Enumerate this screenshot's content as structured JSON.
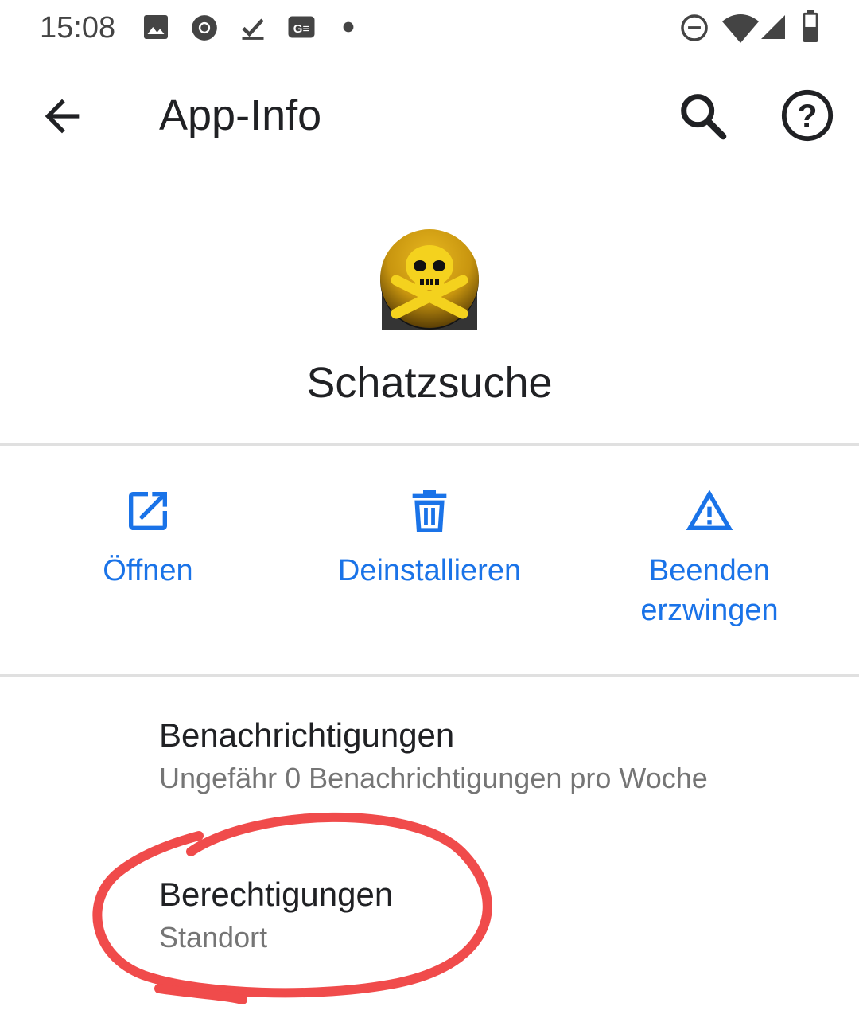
{
  "status_bar": {
    "time": "15:08",
    "icons_left": [
      "image-icon",
      "chrome-icon",
      "download-done-icon",
      "translate-icon",
      "dot-icon"
    ],
    "icons_right": [
      "do-not-disturb-icon",
      "wifi-icon",
      "signal-icon",
      "battery-icon"
    ]
  },
  "appbar": {
    "title": "App-Info",
    "back_icon": "arrow-back-icon",
    "search_icon": "search-icon",
    "help_icon": "help-icon"
  },
  "app": {
    "name": "Schatzsuche",
    "icon": "skull-crossbones-icon"
  },
  "actions": [
    {
      "label": "Öffnen",
      "icon": "open-in-new-icon"
    },
    {
      "label": "Deinstallieren",
      "icon": "trash-icon"
    },
    {
      "label_line1": "Beenden",
      "label_line2": "erzwingen",
      "icon": "warning-icon"
    }
  ],
  "list": [
    {
      "title": "Benachrichtigungen",
      "subtitle": "Ungefähr 0 Benachrichtigungen pro Woche"
    },
    {
      "title": "Berechtigungen",
      "subtitle": "Standort"
    }
  ],
  "colors": {
    "accent": "#1a73e8",
    "annotation": "#f04b4b",
    "divider": "#e0e0e0"
  }
}
